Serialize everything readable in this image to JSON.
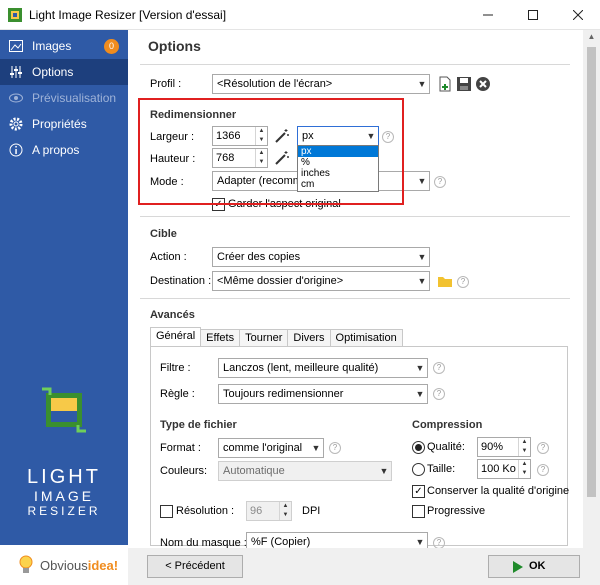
{
  "window": {
    "title": "Light Image Resizer  [Version d'essai]"
  },
  "sidebar": {
    "items": [
      {
        "label": "Images",
        "badge": "0",
        "icon": "images-icon"
      },
      {
        "label": "Options",
        "icon": "sliders-icon"
      },
      {
        "label": "Prévisualisation",
        "icon": "eye-icon"
      },
      {
        "label": "Propriétés",
        "icon": "gear-icon"
      },
      {
        "label": "A propos",
        "icon": "info-icon"
      }
    ],
    "logo_lines": [
      "LIGHT",
      "IMAGE",
      "RESIZER"
    ],
    "brand_a": "Obvious",
    "brand_b": "idea!"
  },
  "options": {
    "heading": "Options",
    "profil_label": "Profil :",
    "profil_value": "<Résolution de l'écran>",
    "resize": {
      "title": "Redimensionner",
      "largeur_label": "Largeur :",
      "largeur_value": "1366",
      "hauteur_label": "Hauteur :",
      "hauteur_value": "768",
      "unit_value": "px",
      "unit_options": [
        "px",
        "%",
        "inches",
        "cm"
      ],
      "mode_label": "Mode :",
      "mode_value": "Adapter (recomman",
      "keep_ratio_label": "Garder l'aspect original"
    },
    "cible": {
      "title": "Cible",
      "action_label": "Action :",
      "action_value": "Créer des copies",
      "destination_label": "Destination :",
      "destination_value": "<Même dossier d'origine>"
    },
    "avances": {
      "title": "Avancés",
      "tabs": [
        "Général",
        "Effets",
        "Tourner",
        "Divers",
        "Optimisation"
      ],
      "filtre_label": "Filtre :",
      "filtre_value": "Lanczos  (lent, meilleure qualité)",
      "regle_label": "Règle :",
      "regle_value": "Toujours redimensionner",
      "filetype_title": "Type de fichier",
      "format_label": "Format :",
      "format_value": "comme l'original",
      "couleurs_label": "Couleurs:",
      "couleurs_value": "Automatique",
      "resolution_label": "Résolution :",
      "resolution_value": "96",
      "dpi_label": "DPI",
      "compression_title": "Compression",
      "qualite_label": "Qualité:",
      "qualite_value": "90%",
      "taille_label": "Taille:",
      "taille_value": "100 Ko",
      "keep_quality_label": "Conserver la qualité d'origine",
      "progressive_label": "Progressive",
      "mask_label": "Nom du masque :",
      "mask_value": "%F (Copier)"
    }
  },
  "footer": {
    "prev_label": "< Précédent",
    "ok_label": "OK"
  },
  "colors": {
    "sidebar": "#2f5aa6",
    "sidebar_active": "#1d3f7d",
    "highlight_box": "#e02020",
    "badge": "#f08c1e",
    "ok_icon": "#1f8a2b",
    "folder_icon": "#f2c230"
  }
}
